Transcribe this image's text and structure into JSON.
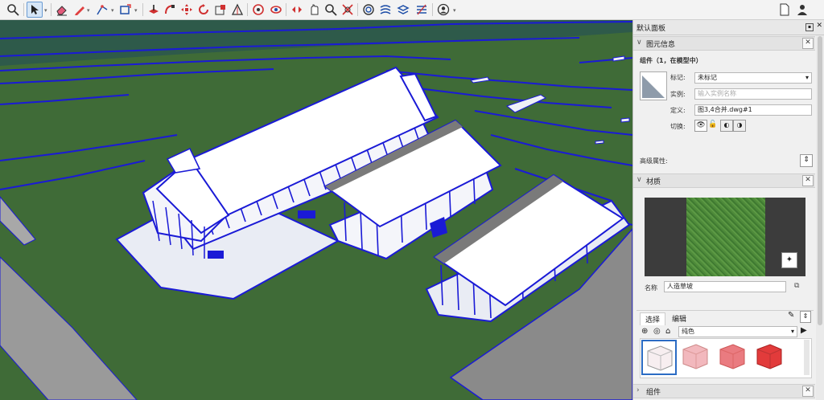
{
  "toolbar": {
    "icons": [
      "search-icon",
      "select-arrow-icon",
      "eraser-icon",
      "pencil-icon",
      "line-icon",
      "rectangle-icon",
      "push-pull-icon",
      "follow-me-icon",
      "move-icon",
      "rotate-icon",
      "scale-icon",
      "tape-measure-icon",
      "orbit-icon",
      "pan-icon",
      "zoom-icon",
      "zoom-extents-icon",
      "section-icon",
      "sandbox-icon",
      "layers-icon",
      "styles-icon",
      "account-icon",
      "new-file-icon",
      "user-icon"
    ]
  },
  "panel": {
    "title": "默认面板",
    "entity_info": {
      "header": "图元信息",
      "component_title": "组件（1，在模型中）",
      "tag_label": "标记:",
      "tag_value": "未标记",
      "instance_label": "实例:",
      "instance_placeholder": "输入实例名称",
      "definition_label": "定义:",
      "definition_value": "图3,4合并.dwg#1",
      "toggle_label": "切换:",
      "advanced_label": "高级属性:"
    },
    "materials": {
      "header": "材质",
      "name_label": "名称",
      "name_value": "人造草坡",
      "tab_select": "选择",
      "tab_edit": "编辑",
      "library_value": "纯色",
      "swatch_colors": [
        "#f7eef0",
        "#f2b8bd",
        "#ea7b80",
        "#e23b3b"
      ]
    },
    "components": {
      "header": "组件"
    }
  },
  "colors": {
    "grass": "#3f6b37",
    "edge_blue": "#1a1ad6",
    "accent": "#2b6cc4"
  }
}
